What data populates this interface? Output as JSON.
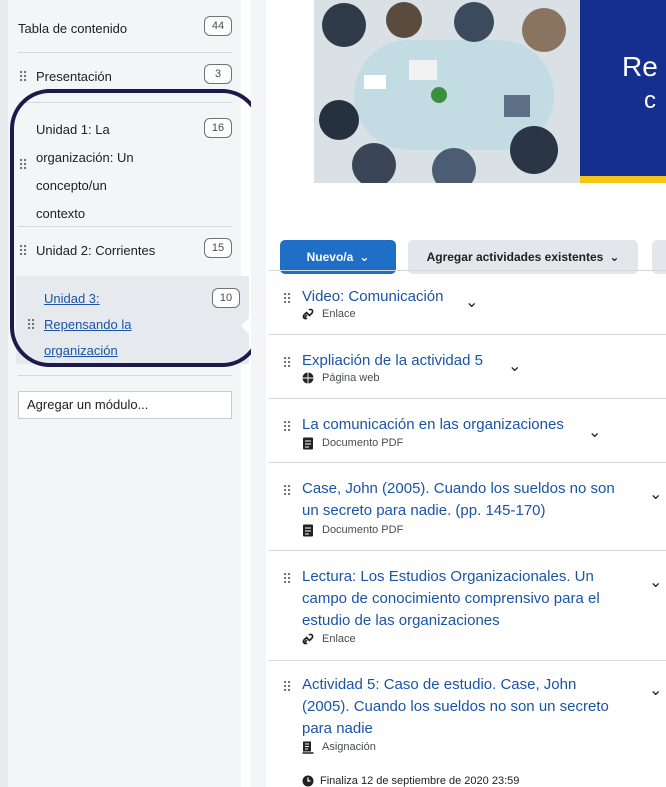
{
  "sidebar": {
    "toc": {
      "label": "Tabla de contenido",
      "count": "44"
    },
    "modules": [
      {
        "label": "Presentación",
        "count": "3"
      },
      {
        "lines": [
          "Unidad 1: La",
          "organización: Un",
          "concepto/un",
          "contexto"
        ],
        "count": "16"
      },
      {
        "label": "Unidad 2: Corrientes",
        "count": "15"
      },
      {
        "lines": [
          "Unidad 3:",
          "Repensando la",
          "organización"
        ],
        "count": "10",
        "selected": true
      }
    ],
    "add_module_placeholder": "Agregar un módulo..."
  },
  "banner": {
    "text_line1": "Re",
    "text_line2": "c"
  },
  "toolbar": {
    "new_label": "Nuevo/a",
    "add_existing_label": "Agregar actividades existentes"
  },
  "items": [
    {
      "title": "Video: Comunicación",
      "type": "Enlace",
      "icon": "link-icon"
    },
    {
      "title": "Expliación de la actividad 5",
      "type": "Página web",
      "icon": "globe-icon"
    },
    {
      "title": "La comunicación en las organizaciones",
      "type": "Documento PDF",
      "icon": "document-icon"
    },
    {
      "title": "Case, John (2005). Cuando los sueldos no son un secreto para nadie. (pp. 145-170)",
      "type": "Documento PDF",
      "icon": "document-icon"
    },
    {
      "title": "Lectura: Los Estudios Organizacionales. Un campo de conocimiento comprensivo para el estudio de las organizaciones",
      "type": "Enlace",
      "icon": "link-icon"
    },
    {
      "title": "Actividad 5: Caso de estudio. Case, John (2005). Cuando los sueldos no son un secreto para nadie",
      "type": "Asignación",
      "icon": "assignment-icon"
    }
  ],
  "due": "Finaliza 12 de septiembre de 2020 23:59",
  "colors": {
    "link": "#1a54a6",
    "primary": "#1f6fc6",
    "ring": "#1b1a4a",
    "banner_blue": "#152f8e"
  }
}
